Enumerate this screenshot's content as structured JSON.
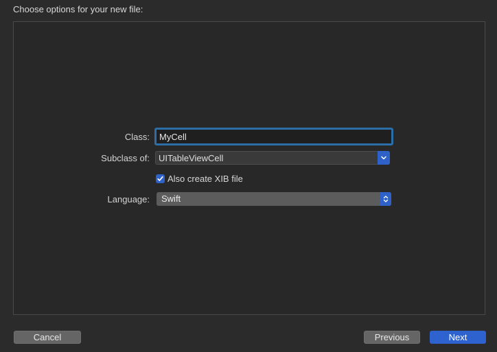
{
  "dialog": {
    "heading": "Choose options for your new file:"
  },
  "form": {
    "class_label": "Class:",
    "class_value": "MyCell",
    "subclass_label": "Subclass of:",
    "subclass_value": "UITableViewCell",
    "xib_checkbox_label": "Also create XIB file",
    "xib_checked": true,
    "language_label": "Language:",
    "language_value": "Swift"
  },
  "footer": {
    "cancel_label": "Cancel",
    "previous_label": "Previous",
    "next_label": "Next"
  },
  "colors": {
    "accent": "#2f62c9",
    "focus_ring": "#2c6ea8",
    "background": "#2b2b2c"
  }
}
